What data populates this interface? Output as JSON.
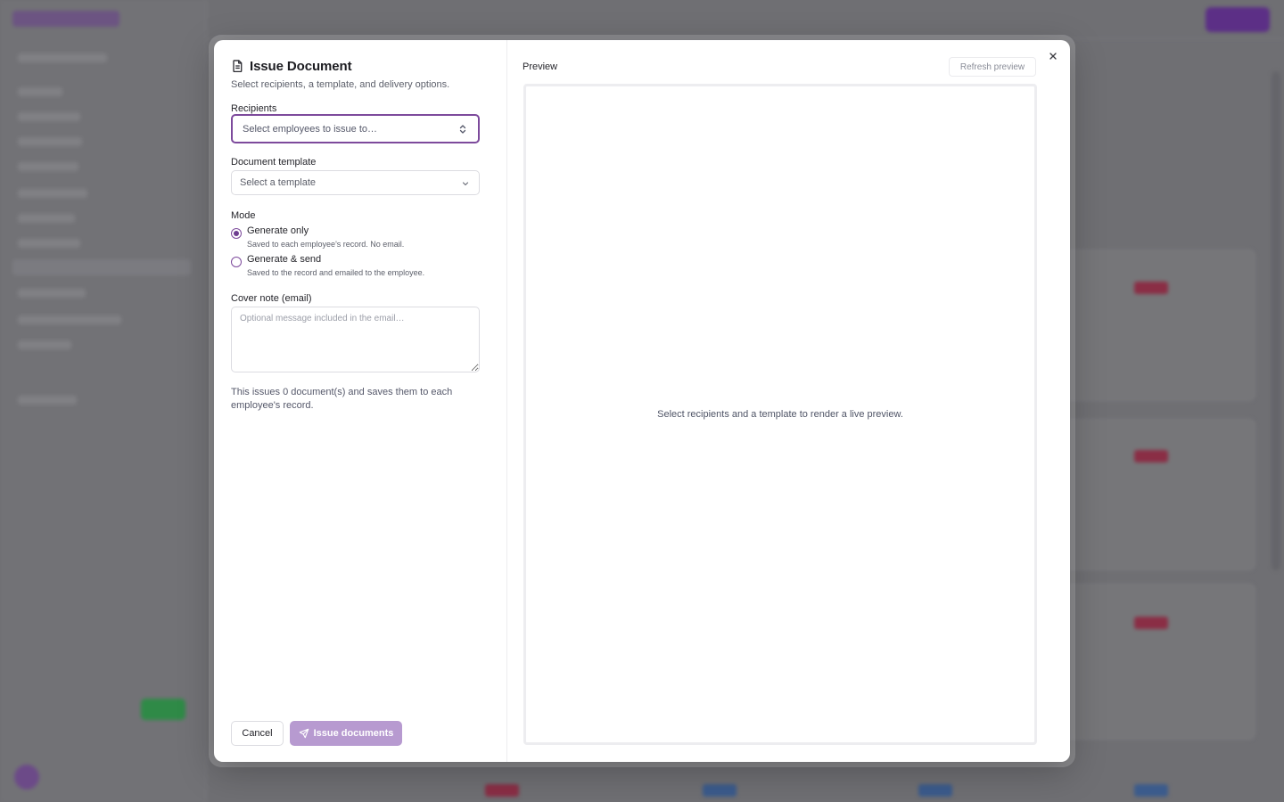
{
  "dialog": {
    "title": "Issue Document",
    "subtitle": "Select recipients, a template, and delivery options.",
    "icon": "document-icon"
  },
  "recipients": {
    "label": "Recipients",
    "placeholder": "Select employees to issue to…"
  },
  "template": {
    "label": "Document template",
    "placeholder": "Select a template"
  },
  "mode": {
    "label": "Mode",
    "options": [
      {
        "label": "Generate only",
        "help": "Saved to each employee's record. No email.",
        "selected": true
      },
      {
        "label": "Generate & send",
        "help": "Saved to the record and emailed to the employee.",
        "selected": false
      }
    ]
  },
  "cover_note": {
    "label": "Cover note (email)",
    "placeholder": "Optional message included in the email…"
  },
  "info_text": "This issues 0 document(s) and saves them to each employee's record.",
  "actions": {
    "cancel": "Cancel",
    "issue": "Issue documents"
  },
  "preview": {
    "label": "Preview",
    "refresh": "Refresh preview",
    "empty_message": "Select recipients and a template to render a live preview."
  },
  "colors": {
    "accent": "#7d4a9c",
    "primary_button_disabled": "#b79ad0"
  }
}
